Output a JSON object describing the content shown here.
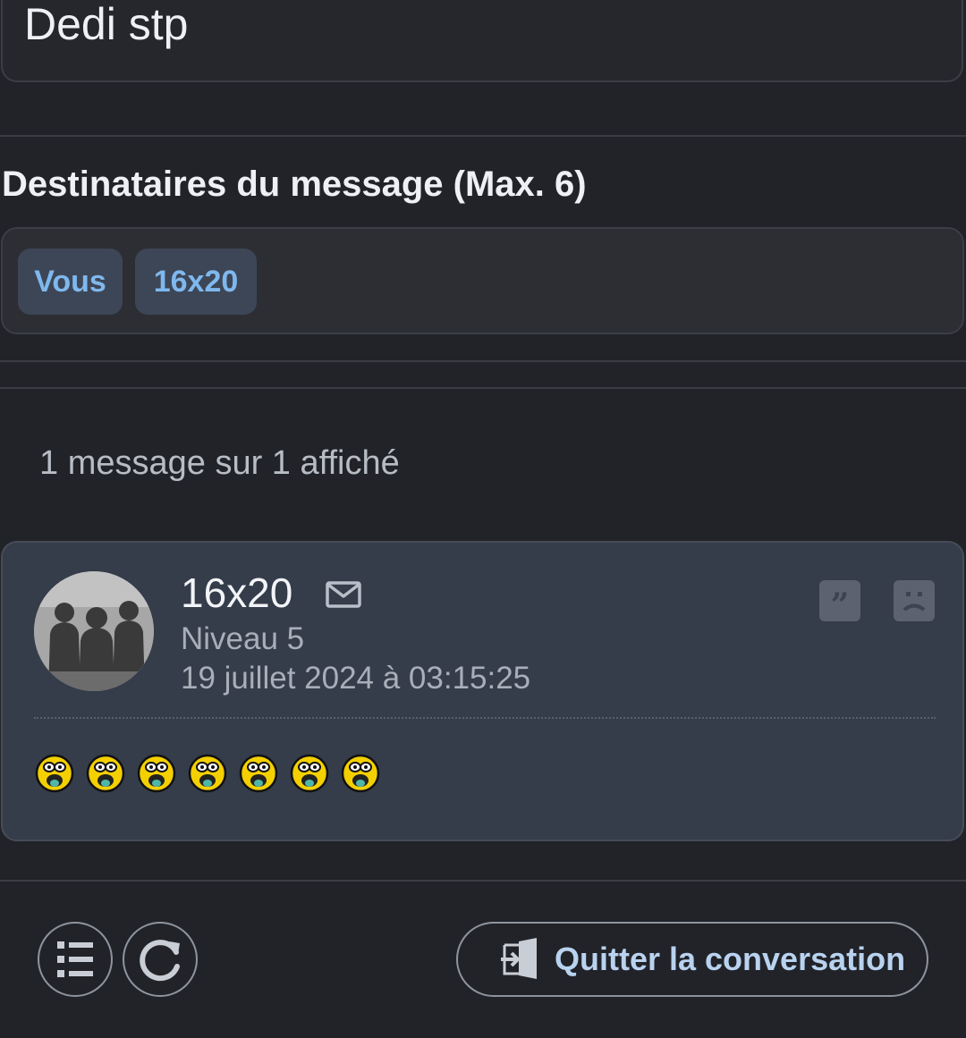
{
  "subject": "Dedi stp",
  "recipients": {
    "title": "Destinataires du message (Max. 6)",
    "chips": [
      "Vous",
      "16x20"
    ]
  },
  "messages_count": "1 message sur 1 affiché",
  "message": {
    "author": "16x20",
    "level": "Niveau 5",
    "date": "19 juillet 2024 à 03:15:25",
    "smiley_count": 7
  },
  "footer": {
    "quit_label": "Quitter la conversation"
  },
  "colors": {
    "background": "#212328",
    "card": "#353c4a",
    "chip_text": "#7fb8ee",
    "quit_text": "#b9d2ef"
  },
  "icons": [
    "mail-icon",
    "quote-icon",
    "report-icon",
    "list-icon",
    "refresh-icon",
    "exit-door-icon",
    "drooling-smiley-icon"
  ]
}
